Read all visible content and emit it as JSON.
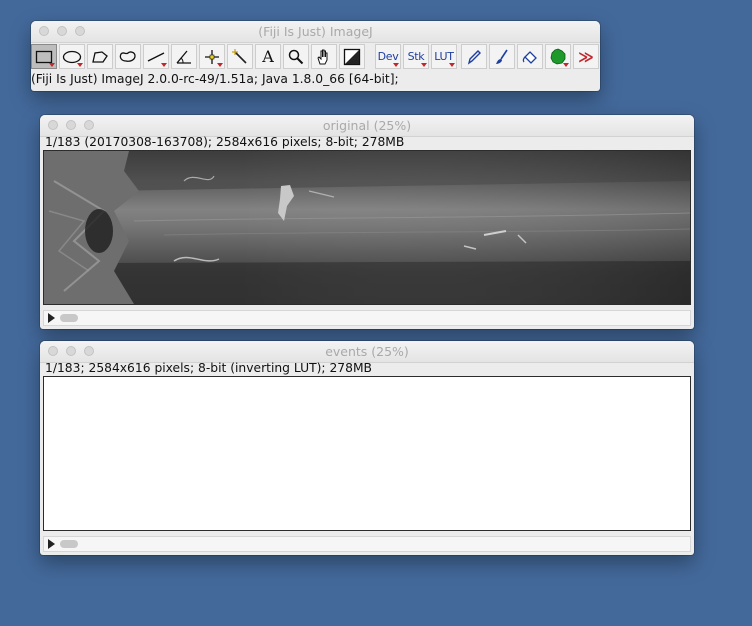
{
  "imagej": {
    "title": "(Fiji Is Just) ImageJ",
    "status": "(Fiji Is Just) ImageJ 2.0.0-rc-49/1.51a; Java 1.8.0_66 [64-bit];",
    "tools": [
      {
        "name": "rectangle-tool",
        "icon": "rectangle-icon",
        "selected": true
      },
      {
        "name": "oval-tool",
        "icon": "oval-icon"
      },
      {
        "name": "polygon-tool",
        "icon": "polygon-icon"
      },
      {
        "name": "freehand-tool",
        "icon": "freehand-icon"
      },
      {
        "name": "line-tool",
        "icon": "line-icon"
      },
      {
        "name": "angle-tool",
        "icon": "angle-icon"
      },
      {
        "name": "point-tool",
        "icon": "point-icon"
      },
      {
        "name": "wand-tool",
        "icon": "wand-icon"
      },
      {
        "name": "text-tool",
        "icon": "text-icon",
        "label": "A"
      },
      {
        "name": "magnifier-tool",
        "icon": "magnifier-icon"
      },
      {
        "name": "hand-tool",
        "icon": "hand-icon"
      },
      {
        "name": "color-picker-tool",
        "icon": "color-picker-icon"
      },
      {
        "name": "dev-tool",
        "icon": "dev-menu",
        "label": "Dev"
      },
      {
        "name": "stk-tool",
        "icon": "stack-menu",
        "label": "Stk"
      },
      {
        "name": "lut-tool",
        "icon": "lut-menu",
        "label": "LUT"
      },
      {
        "name": "pencil-tool",
        "icon": "pencil-icon"
      },
      {
        "name": "brush-tool",
        "icon": "brush-icon"
      },
      {
        "name": "flood-fill-tool",
        "icon": "flood-fill-icon"
      },
      {
        "name": "drawing-tools",
        "icon": "green-blob-icon"
      },
      {
        "name": "more-tools",
        "icon": "double-chevron-icon",
        "label": "≫"
      }
    ]
  },
  "original": {
    "title": "original (25%)",
    "info": "1/183 (20170308-163708); 2584x616 pixels; 8-bit; 278MB"
  },
  "events": {
    "title": "events (25%)",
    "info": "1/183; 2584x616 pixels; 8-bit (inverting LUT); 278MB"
  },
  "colors": {
    "desktop": "#43699b",
    "dropdown_marker": "#c0262b",
    "tool_text": "#1d3fa0"
  }
}
